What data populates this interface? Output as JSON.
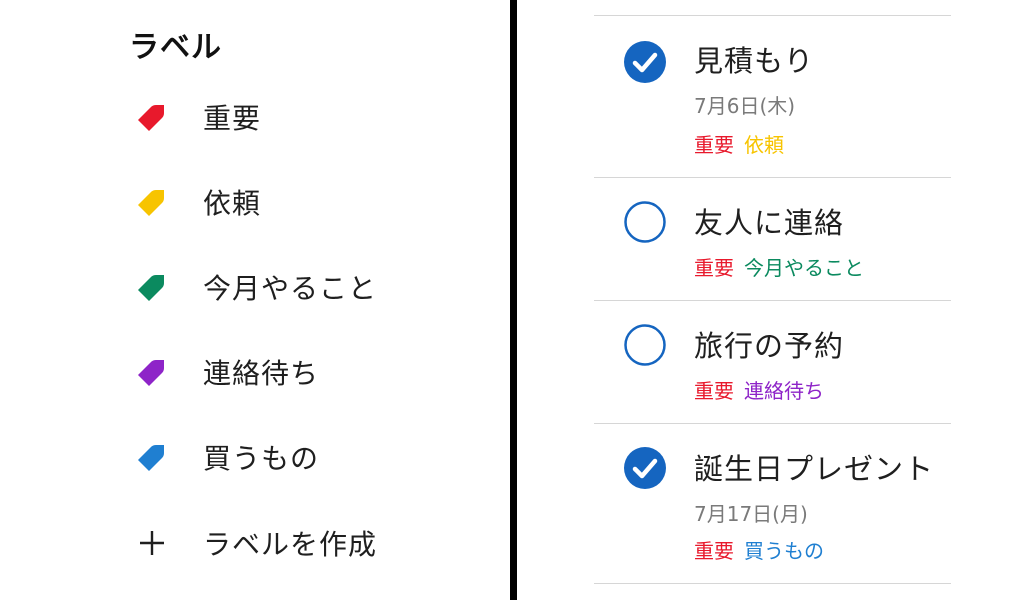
{
  "colors": {
    "important": "#e8192c",
    "request": "#f7c400",
    "this_month": "#0b8a5f",
    "waiting": "#8e24c8",
    "shopping": "#1f7fd1",
    "check_blue": "#1565c0"
  },
  "labels_panel": {
    "title": "ラベル",
    "items": [
      {
        "label": "重要",
        "icon": "tag-icon",
        "color": "#e8192c"
      },
      {
        "label": "依頼",
        "icon": "tag-icon",
        "color": "#f7c400"
      },
      {
        "label": "今月やること",
        "icon": "tag-icon",
        "color": "#0b8a5f"
      },
      {
        "label": "連絡待ち",
        "icon": "tag-icon",
        "color": "#8e24c8"
      },
      {
        "label": "買うもの",
        "icon": "tag-icon",
        "color": "#1f7fd1"
      }
    ],
    "create": {
      "label": "ラベルを作成",
      "icon": "plus-icon"
    }
  },
  "tasks": [
    {
      "title": "見積もり",
      "done": true,
      "date": "7月6日(木)",
      "labels": [
        {
          "text": "重要",
          "color": "#e8192c"
        },
        {
          "text": "依頼",
          "color": "#f7c400"
        }
      ]
    },
    {
      "title": "友人に連絡",
      "done": false,
      "labels": [
        {
          "text": "重要",
          "color": "#e8192c"
        },
        {
          "text": "今月やること",
          "color": "#0b8a5f"
        }
      ]
    },
    {
      "title": "旅行の予約",
      "done": false,
      "labels": [
        {
          "text": "重要",
          "color": "#e8192c"
        },
        {
          "text": "連絡待ち",
          "color": "#8e24c8"
        }
      ]
    },
    {
      "title": "誕生日プレゼント",
      "done": true,
      "date": "7月17日(月)",
      "labels": [
        {
          "text": "重要",
          "color": "#e8192c"
        },
        {
          "text": "買うもの",
          "color": "#1f7fd1"
        }
      ]
    }
  ]
}
